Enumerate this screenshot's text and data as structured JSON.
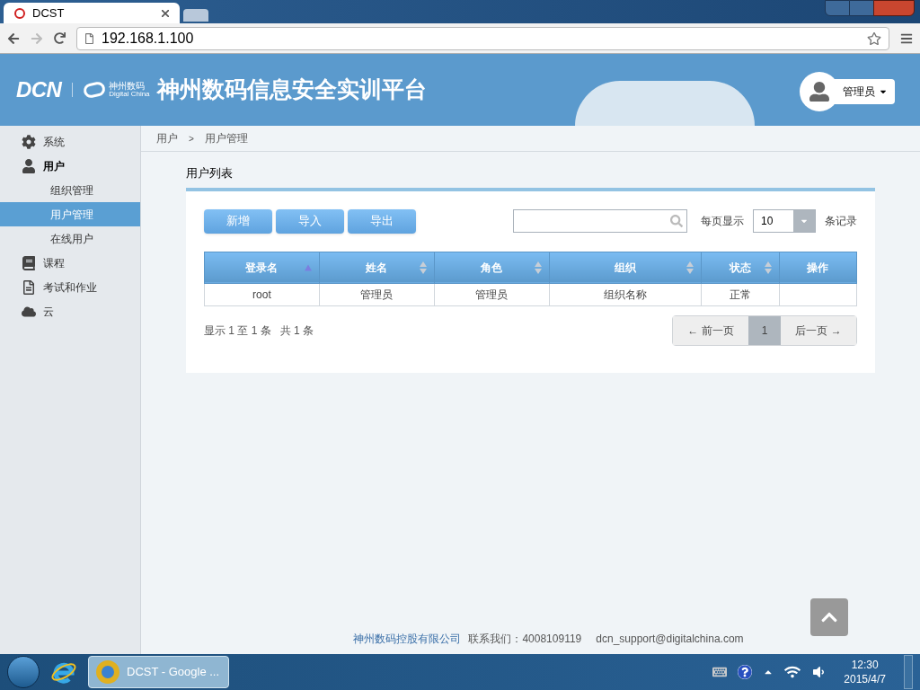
{
  "browser": {
    "tab_title": "DCST",
    "url": "192.168.1.100"
  },
  "header": {
    "logo_text": "DCN",
    "brand_cn": "神州数码",
    "brand_en": "Digital China",
    "title": "神州数码信息安全实训平台",
    "user": "管理员"
  },
  "sidebar": {
    "items": [
      {
        "label": "系统",
        "kind": "gear",
        "expanded": false
      },
      {
        "label": "用户",
        "kind": "user",
        "expanded": true,
        "children": [
          {
            "label": "组织管理",
            "selected": false
          },
          {
            "label": "用户管理",
            "selected": true
          },
          {
            "label": "在线用户",
            "selected": false
          }
        ]
      },
      {
        "label": "课程",
        "kind": "book",
        "expanded": false
      },
      {
        "label": "考试和作业",
        "kind": "doc",
        "expanded": false
      },
      {
        "label": "云",
        "kind": "cloud",
        "expanded": false
      }
    ]
  },
  "breadcrumb": [
    "用户",
    "用户管理"
  ],
  "breadcrumb_separator": ">",
  "panel_title": "用户列表",
  "buttons": [
    "新增",
    "导入",
    "导出"
  ],
  "page_size": {
    "label": "每页显示",
    "value": "10",
    "suffix": "条记录"
  },
  "table": {
    "columns": [
      {
        "label": "登录名",
        "sortable": true,
        "sorted": true
      },
      {
        "label": "姓名",
        "sortable": true,
        "sorted": false
      },
      {
        "label": "角色",
        "sortable": true,
        "sorted": false
      },
      {
        "label": "组织",
        "sortable": true,
        "sorted": false
      },
      {
        "label": "状态",
        "sortable": true,
        "sorted": false
      },
      {
        "label": "操作",
        "sortable": false
      }
    ],
    "rows": [
      [
        "root",
        "管理员",
        "管理员",
        "组织名称",
        "正常",
        ""
      ]
    ]
  },
  "summary": "显示 1 至 1 条   共 1 条",
  "pagination": {
    "prev": "← 前一页",
    "pages": [
      {
        "label": "1",
        "selected": true
      }
    ],
    "next": "后一页 →"
  },
  "footer": {
    "company": "神州数码控股有限公司",
    "contact": "联系我们：4008109119",
    "email": "dcn_support@digitalchina.com"
  },
  "taskbar": {
    "window_label": "DCST - Google ...",
    "time": "12:30",
    "date": "2015/4/7"
  }
}
